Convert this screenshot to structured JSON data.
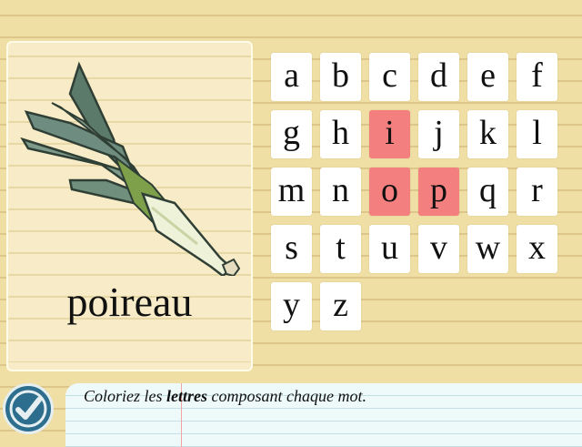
{
  "card": {
    "image_icon": "leek-icon",
    "word": "poireau"
  },
  "letters": [
    {
      "ch": "a",
      "selected": false
    },
    {
      "ch": "b",
      "selected": false
    },
    {
      "ch": "c",
      "selected": false
    },
    {
      "ch": "d",
      "selected": false
    },
    {
      "ch": "e",
      "selected": false
    },
    {
      "ch": "f",
      "selected": false
    },
    {
      "ch": "g",
      "selected": false
    },
    {
      "ch": "h",
      "selected": false
    },
    {
      "ch": "i",
      "selected": true
    },
    {
      "ch": "j",
      "selected": false
    },
    {
      "ch": "k",
      "selected": false
    },
    {
      "ch": "l",
      "selected": false
    },
    {
      "ch": "m",
      "selected": false
    },
    {
      "ch": "n",
      "selected": false
    },
    {
      "ch": "o",
      "selected": true
    },
    {
      "ch": "p",
      "selected": true
    },
    {
      "ch": "q",
      "selected": false
    },
    {
      "ch": "r",
      "selected": false
    },
    {
      "ch": "s",
      "selected": false
    },
    {
      "ch": "t",
      "selected": false
    },
    {
      "ch": "u",
      "selected": false
    },
    {
      "ch": "v",
      "selected": false
    },
    {
      "ch": "w",
      "selected": false
    },
    {
      "ch": "x",
      "selected": false
    },
    {
      "ch": "y",
      "selected": false
    },
    {
      "ch": "z",
      "selected": false
    }
  ],
  "instruction": {
    "before": "Coloriez les ",
    "bold": "lettres",
    "after": " composant chaque mot."
  },
  "ok_button_icon": "checkmark-icon",
  "colors": {
    "selected_tile": "#f47f7f",
    "tile": "#ffffff",
    "ok_button": "#2d6d8d"
  }
}
